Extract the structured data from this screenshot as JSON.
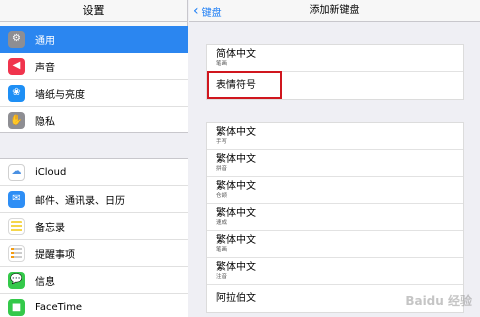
{
  "left": {
    "title": "设置",
    "group1": [
      {
        "label": "通用",
        "icon": "gear-icon",
        "selected": true
      },
      {
        "label": "声音",
        "icon": "speaker-icon"
      },
      {
        "label": "墙纸与亮度",
        "icon": "flower-icon"
      },
      {
        "label": "隐私",
        "icon": "hand-icon"
      }
    ],
    "group2": [
      {
        "label": "iCloud",
        "icon": "cloud-icon"
      },
      {
        "label": "邮件、通讯录、日历",
        "icon": "mail-icon"
      },
      {
        "label": "备忘录",
        "icon": "notes-icon"
      },
      {
        "label": "提醒事项",
        "icon": "reminders-icon"
      },
      {
        "label": "信息",
        "icon": "messages-icon"
      },
      {
        "label": "FaceTime",
        "icon": "facetime-icon"
      }
    ]
  },
  "right": {
    "back_label": "键盘",
    "title": "添加新键盘",
    "group1": [
      {
        "name": "简体中文",
        "sub": "笔画"
      },
      {
        "name": "表情符号",
        "sub": ""
      }
    ],
    "group2": [
      {
        "name": "繁体中文",
        "sub": "手写"
      },
      {
        "name": "繁体中文",
        "sub": "拼音"
      },
      {
        "name": "繁体中文",
        "sub": "仓颉"
      },
      {
        "name": "繁体中文",
        "sub": "速成"
      },
      {
        "name": "繁体中文",
        "sub": "笔画"
      },
      {
        "name": "繁体中文",
        "sub": "注音"
      },
      {
        "name": "阿拉伯文",
        "sub": ""
      }
    ]
  },
  "watermark": "Baidu 经验",
  "colors": {
    "accent": "#2b86f0",
    "highlight": "#d0161e",
    "link": "#1a7cf5"
  }
}
